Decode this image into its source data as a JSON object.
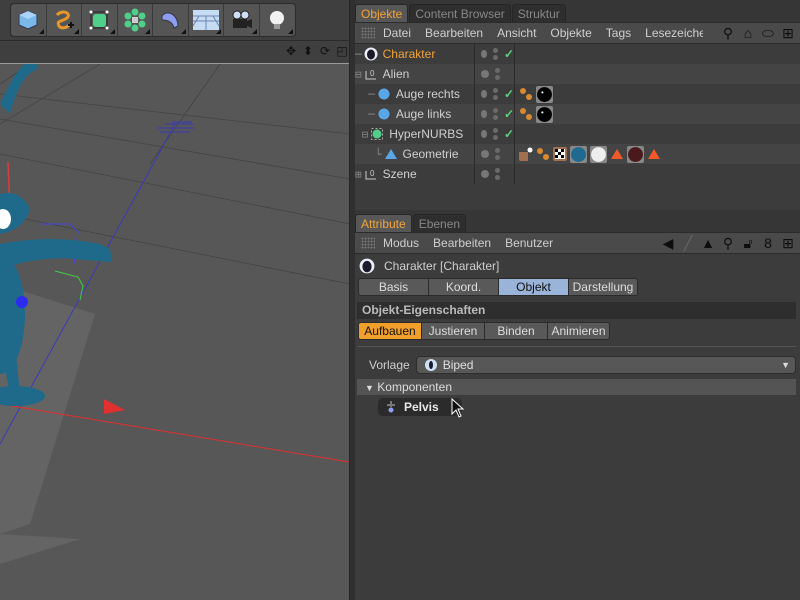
{
  "toolbar": {
    "tools": [
      {
        "name": "cube",
        "icon": "cube-icon"
      },
      {
        "name": "spline",
        "icon": "spline-pen-icon"
      },
      {
        "name": "subdivision",
        "icon": "subdivision-surface-icon"
      },
      {
        "name": "array",
        "icon": "array-icon"
      },
      {
        "name": "deformer",
        "icon": "bend-deformer-icon"
      },
      {
        "name": "floor",
        "icon": "floor-icon"
      },
      {
        "name": "camera",
        "icon": "camera-icon"
      },
      {
        "name": "light",
        "icon": "light-bulb-icon"
      }
    ]
  },
  "viewport": {
    "nav_icons": [
      "move-icon",
      "zoom-icon",
      "rotate-icon",
      "maximize-icon"
    ]
  },
  "object_manager": {
    "tabs": [
      {
        "label": "Objekte",
        "active": true
      },
      {
        "label": "Content Browser",
        "active": false
      },
      {
        "label": "Struktur",
        "active": false
      }
    ],
    "menu": [
      "Datei",
      "Bearbeiten",
      "Ansicht",
      "Objekte",
      "Tags",
      "Lesezeichen"
    ],
    "objects": [
      {
        "name": "Charakter",
        "highlight": true,
        "prefix": "─",
        "icon": "character",
        "check": true,
        "tags": []
      },
      {
        "name": "Alien",
        "prefix": "⊟",
        "icon": "null",
        "check": false,
        "tags": []
      },
      {
        "name": "Auge rechts",
        "prefix": "  ─",
        "icon": "sphere",
        "check": true,
        "tags": [
          "phong",
          "material-black"
        ]
      },
      {
        "name": "Auge links",
        "prefix": "  ─",
        "icon": "sphere",
        "check": true,
        "tags": [
          "phong",
          "material-black"
        ]
      },
      {
        "name": "HyperNURBS",
        "prefix": " ⊟",
        "icon": "hypernurbs",
        "check": true,
        "tags": []
      },
      {
        "name": "Geometrie",
        "prefix": "   └",
        "icon": "polygon",
        "check": false,
        "tags": [
          "weight",
          "phong",
          "uvw",
          "material-blue",
          "material-white",
          "selection",
          "material-brown",
          "selection"
        ]
      },
      {
        "name": "Szene",
        "prefix": "⊞",
        "icon": "null",
        "check": false,
        "tags": []
      }
    ]
  },
  "attribute_manager": {
    "tabs": [
      {
        "label": "Attribute",
        "active": true
      },
      {
        "label": "Ebenen",
        "active": false
      }
    ],
    "menu": [
      "Modus",
      "Bearbeiten",
      "Benutzer"
    ],
    "object_title": "Charakter [Charakter]",
    "main_tabs": [
      {
        "label": "Basis",
        "selected": false
      },
      {
        "label": "Koord.",
        "selected": false
      },
      {
        "label": "Objekt",
        "selected": true
      },
      {
        "label": "Darstellung",
        "selected": false
      }
    ],
    "section_title": "Objekt-Eigenschaften",
    "sub_tabs": [
      {
        "label": "Aufbauen",
        "selected": true
      },
      {
        "label": "Justieren",
        "selected": false
      },
      {
        "label": "Binden",
        "selected": false
      },
      {
        "label": "Animieren",
        "selected": false
      }
    ],
    "vorlage_label": "Vorlage",
    "vorlage_value": "Biped",
    "komponenten_label": "Komponenten",
    "component_button": "Pelvis"
  },
  "colors": {
    "accent": "#f2a33a",
    "selected_tab": "#9ab3d8",
    "check": "#5cd17c"
  }
}
